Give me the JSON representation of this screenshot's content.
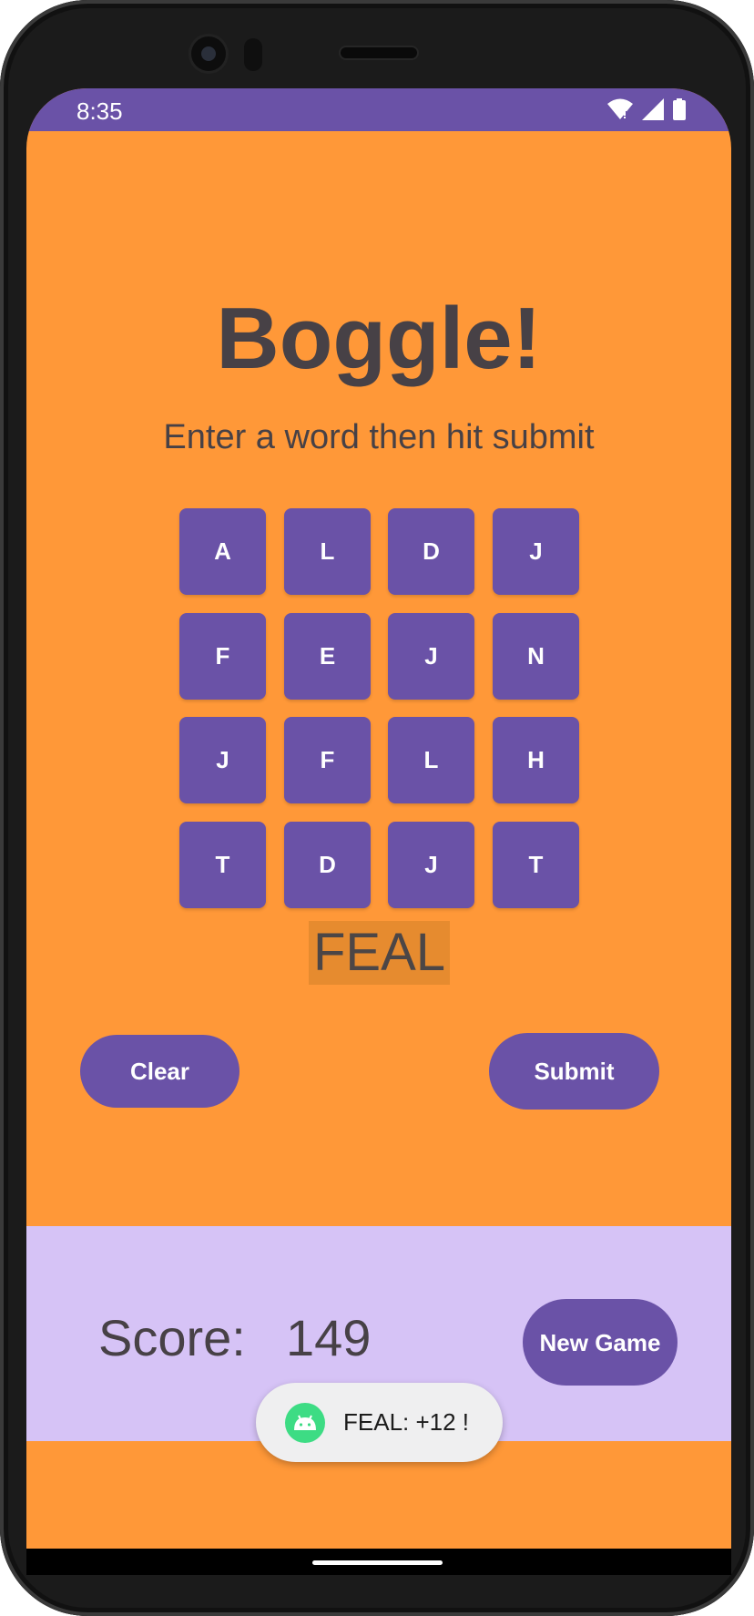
{
  "status_bar": {
    "time": "8:35",
    "icons": [
      "wifi-icon",
      "signal-icon",
      "battery-icon"
    ]
  },
  "app": {
    "title": "Boggle!",
    "subtitle": "Enter a word then hit submit"
  },
  "board": {
    "rows": [
      [
        "A",
        "L",
        "D",
        "J"
      ],
      [
        "F",
        "E",
        "J",
        "N"
      ],
      [
        "J",
        "F",
        "L",
        "H"
      ],
      [
        "T",
        "D",
        "J",
        "T"
      ]
    ]
  },
  "current_word": "FEAL",
  "buttons": {
    "clear": "Clear",
    "submit": "Submit",
    "new_game": "New Game"
  },
  "score": {
    "label": "Score:",
    "value": "149"
  },
  "toast": {
    "icon": "android-icon",
    "text": "FEAL: +12 !"
  },
  "colors": {
    "background": "#ff9838",
    "accent": "#6a52a7",
    "score_panel": "#d6c3f6",
    "word_highlight": "#e68b2f",
    "text": "#474146"
  }
}
